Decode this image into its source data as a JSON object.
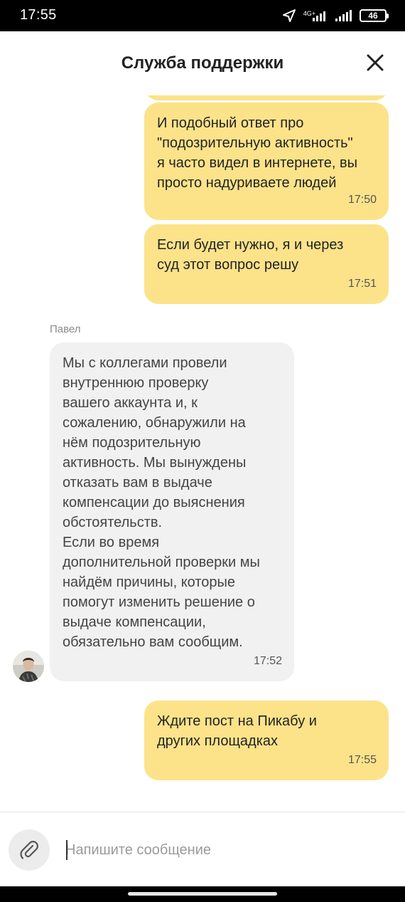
{
  "status_bar": {
    "time": "17:55",
    "network_label": "4G+",
    "battery": "46",
    "icons": [
      "location-arrow-icon",
      "signal-4g-icon",
      "signal-icon",
      "battery-icon"
    ]
  },
  "header": {
    "title": "Служба поддержки",
    "close_icon": "close-icon"
  },
  "messages": [
    {
      "direction": "out",
      "text": "И подобный ответ про\n\"подозрительную активность\"\nя часто видел в интернете, вы\nпросто надуриваете людей",
      "time": "17:50"
    },
    {
      "direction": "out",
      "text": "Если будет нужно, я и через\nсуд этот вопрос решу",
      "time": "17:51"
    },
    {
      "direction": "in",
      "sender": "Павел",
      "text": "Мы с коллегами провели\nвнутреннюю проверку\nвашего аккаунта и, к\nсожалению, обнаружили на\nнём подозрительную\nактивность. Мы вынуждены\nотказать вам в выдаче\nкомпенсации до выяснения\nобстоятельств.\nЕсли во время\nдополнительной проверки мы\nнайдём причины, которые\nпомогут изменить решение о\nвыдаче компенсации,\nобязательно вам сообщим.",
      "time": "17:52"
    },
    {
      "direction": "out",
      "text": "Ждите пост на Пикабу и\nдругих площадках",
      "time": "17:55"
    }
  ],
  "composer": {
    "placeholder": "Напишите сообщение",
    "value": "",
    "attach_icon": "paperclip-icon"
  },
  "colors": {
    "outgoing_bubble": "#fce38a",
    "incoming_bubble": "#f1f1f1",
    "sender_name": "#8a8a8a"
  }
}
